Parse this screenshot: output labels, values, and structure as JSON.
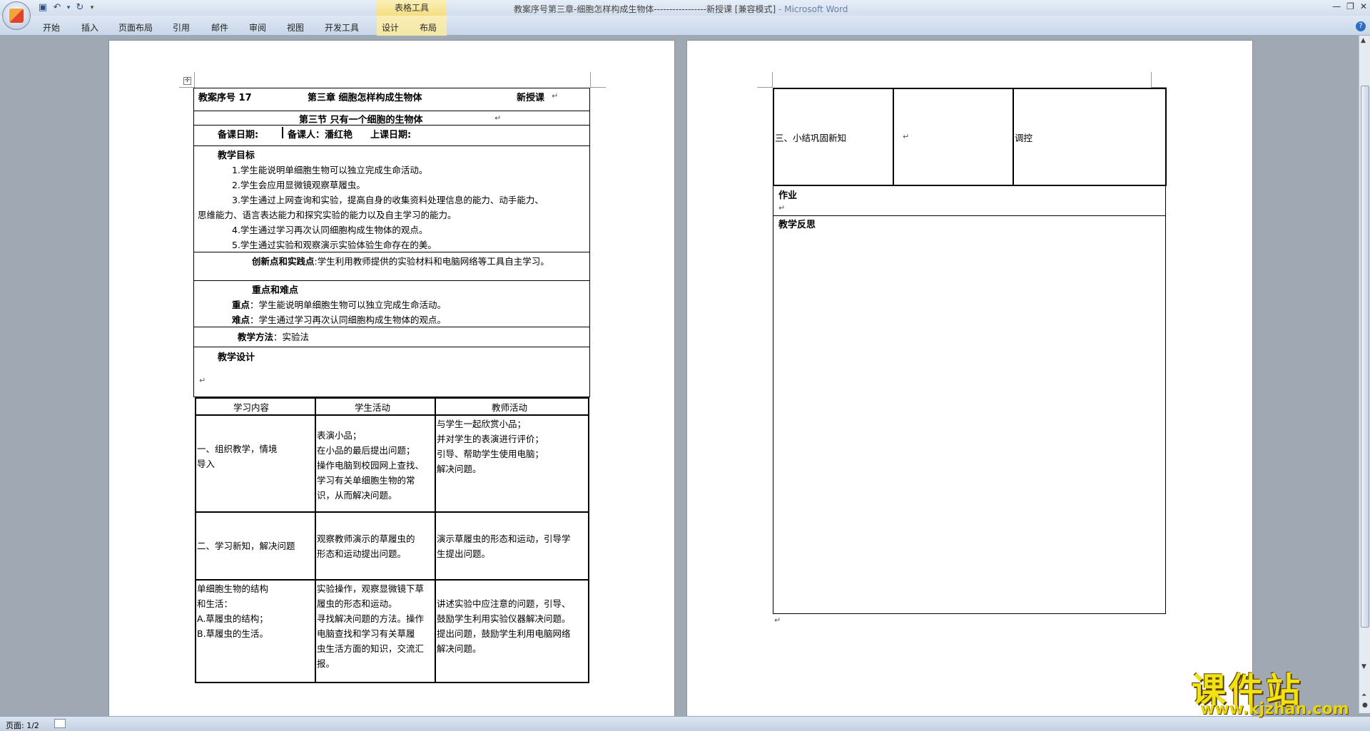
{
  "window": {
    "title": "教案序号第三章-细胞怎样构成生物体-----------------新授课 [兼容模式]",
    "app": " - Microsoft Word",
    "context_group": "表格工具"
  },
  "ribbon": {
    "tabs": [
      "开始",
      "插入",
      "页面布局",
      "引用",
      "邮件",
      "审阅",
      "视图",
      "开发工具",
      "设计",
      "布局"
    ]
  },
  "page1": {
    "header": {
      "lesson_no": "教案序号 17",
      "chapter": "第三章 细胞怎样构成生物体",
      "type": "新授课"
    },
    "section": "第三节  只有一个细胞的生物体",
    "meta": {
      "prep_date": "备课日期:",
      "preparer": "备课人：潘红艳",
      "class_date": "上课日期:"
    },
    "goals": {
      "title": "教学目标",
      "items": [
        "1.学生能说明单细胞生物可以独立完成生命活动。",
        "2.学生会应用显微镜观察草履虫。",
        "3.学生通过上网查询和实验，提高自身的收集资料处理信息的能力、动手能力、",
        "思维能力、语言表达能力和探究实验的能力以及自主学习的能力。",
        "4.学生通过学习再次认同细胞构成生物体的观点。",
        "5.学生通过实验和观察演示实验体验生命存在的美。"
      ]
    },
    "innovation": {
      "label": "创新点和实践点",
      "text": ":学生利用教师提供的实验材料和电脑网络等工具自主学习。"
    },
    "keypoints": {
      "title": "重点和难点",
      "key_label": "重点",
      "key_text": "：学生能说明单细胞生物可以独立完成生命活动。",
      "diff_label": "难点",
      "diff_text": "：学生通过学习再次认同细胞构成生物体的观点。"
    },
    "method": {
      "label": "教学方法",
      "text": "：实验法"
    },
    "design": {
      "title": "教学设计"
    },
    "table": {
      "headers": [
        "学习内容",
        "学生活动",
        "教师活动"
      ],
      "rows": [
        {
          "content": [
            "一、组织教学，情境",
            "导入"
          ],
          "student": [
            "表演小品；",
            "在小品的最后提出问题；",
            "操作电脑到校园网上查找、",
            "学习有关单细胞生物的常",
            "识，从而解决问题。"
          ],
          "teacher": [
            "与学生一起欣赏小品；",
            "并对学生的表演进行评价；",
            "引导、帮助学生使用电脑；",
            "解决问题。"
          ]
        },
        {
          "content": [
            "二、学习新知，解决问题"
          ],
          "student": [
            "观察教师演示的草履虫的",
            "形态和运动提出问题。"
          ],
          "teacher": [
            "演示草履虫的形态和运动，引导学",
            "生提出问题。"
          ]
        },
        {
          "content": [
            "单细胞生物的结构",
            "和生活：",
            "A.草履虫的结构；",
            "B.草履虫的生活。"
          ],
          "student": [
            "实验操作，观察显微镜下草",
            "履虫的形态和运动。",
            "寻找解决问题的方法。操作",
            "电脑查找和学习有关草履",
            "虫生活方面的知识，交流汇",
            "报。"
          ],
          "teacher": [
            "讲述实验中应注意的问题，引导、",
            "鼓励学生利用实验仪器解决问题。",
            "提出问题，鼓励学生利用电脑网络",
            "解决问题。"
          ]
        }
      ]
    }
  },
  "page2": {
    "row_content": "三、小结巩固新知",
    "row_teacher": "调控",
    "homework": "作业",
    "reflection": "教学反思"
  },
  "status": {
    "page": "页面: 1/2"
  },
  "watermark": {
    "big": "课件站",
    "url": "www.kjzhan.com"
  }
}
